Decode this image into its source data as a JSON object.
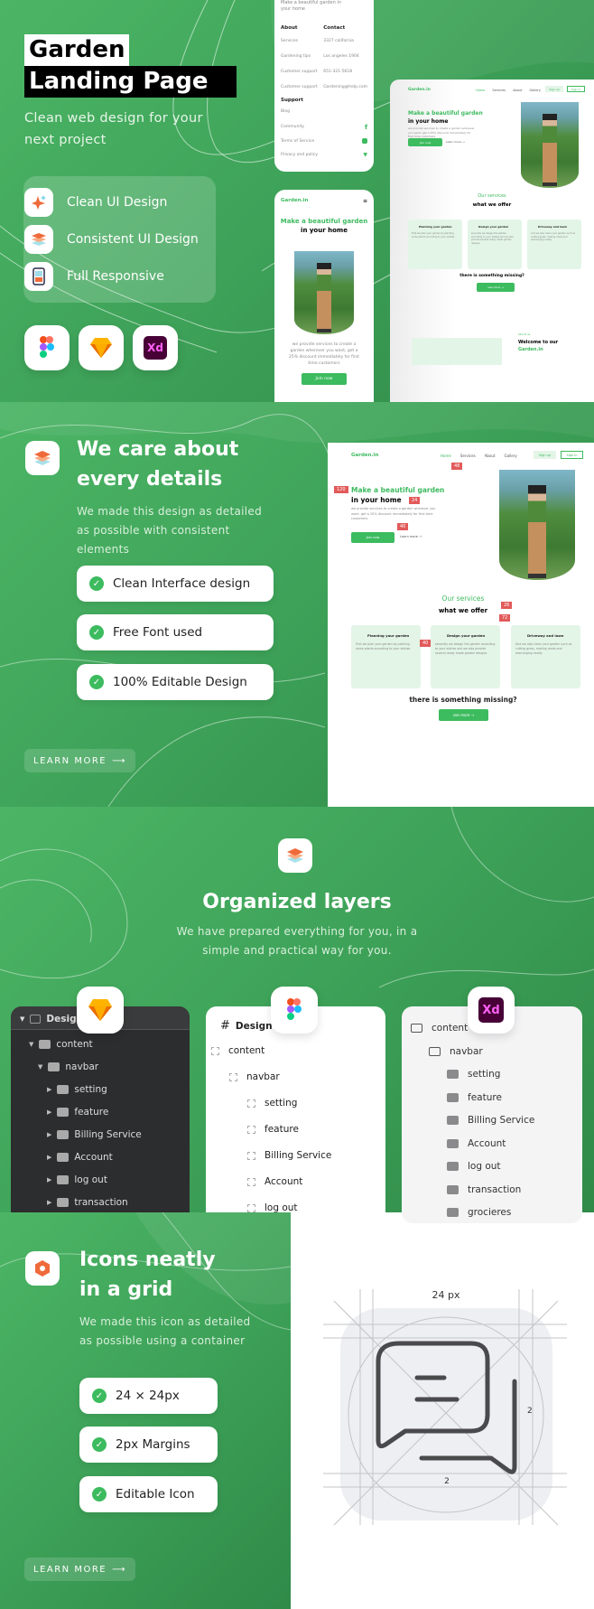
{
  "colors": {
    "brand_green": "#3dbb5f",
    "bg_green": "#3fa45a",
    "badge_red": "#e25a5a",
    "dark_panel": "#2c2d2e"
  },
  "hero": {
    "title_line1": "Garden",
    "title_line2": "Landing Page",
    "subtitle": "Clean web design for your next project",
    "features": [
      {
        "icon": "sparkle-icon",
        "label": "Clean UI Design"
      },
      {
        "icon": "layers-icon",
        "label": "Consistent UI Design"
      },
      {
        "icon": "phone-icon",
        "label": "Full Responsive"
      }
    ],
    "tools": [
      {
        "icon": "figma-icon"
      },
      {
        "icon": "sketch-icon"
      },
      {
        "icon": "xd-icon",
        "label": "Xd"
      }
    ]
  },
  "mock_footer": {
    "tagline": "Make a beautiful garden in your home",
    "about_title": "About",
    "contact_title": "Contact",
    "about": [
      "Services",
      "Gardening tips",
      "Customer support",
      "Customer support"
    ],
    "contact": [
      "3327 california",
      "Los angeles 1904",
      "651-321-5618",
      "Gardening@help.com"
    ],
    "support_title": "Support",
    "support": [
      "Blog",
      "Community",
      "Terms of Service",
      "Privacy and policy"
    ]
  },
  "mock_site": {
    "logo": "Garden.in",
    "nav": [
      "Home",
      "Services",
      "About",
      "Gallery"
    ],
    "signup": "Sign up",
    "signin": "Sign in",
    "hero_green": "Make a beautiful garden",
    "hero_dark": "in your home",
    "hero_text": "we provide services to create a garden wherever you want, get a 25% discount immediately for first time customers",
    "join": "Join now",
    "learn": "Learn more →",
    "services_kicker": "Our services",
    "services_title": "what we offer",
    "services": [
      {
        "title": "Planning your garden",
        "text": "First we plan your garden by planting some plants according to your wishes"
      },
      {
        "title": "Design your garden",
        "text": "secondly we design the garden according to your wishes and we also provide several ready made garden designs"
      },
      {
        "title": "Driveway and lawn",
        "text": "And we also clean your garden such as cutting grass, making roads and rearranging neatly"
      }
    ],
    "missing": "there is something missing?",
    "see_more": "see more →",
    "about_kicker": "About us",
    "about_title1": "Welcome to our",
    "about_title2": "Garden.in",
    "spacing": [
      "48",
      "120",
      "24",
      "40",
      "26",
      "72",
      "40"
    ]
  },
  "details": {
    "title_line1": "We care about",
    "title_line2": "every details",
    "subtitle": "We made this design as detailed as possible with consistent elements",
    "pills": [
      "Clean Interface design",
      "Free Font used",
      "100% Editable Design"
    ],
    "learn_more": "LEARN MORE"
  },
  "layers": {
    "title": "Organized layers",
    "subtitle": "We have prepared everything for you, in a simple and practical way for you.",
    "sketch": {
      "root": "Design",
      "items": [
        "content",
        "navbar",
        "setting",
        "feature",
        "Billing Service",
        "Account",
        "log out",
        "transaction"
      ]
    },
    "figma": {
      "root": "Design",
      "items": [
        "content",
        "navbar",
        "setting",
        "feature",
        "Billing Service",
        "Account",
        "log out"
      ]
    },
    "xd": {
      "items": [
        "content",
        "navbar",
        "setting",
        "feature",
        "Billing Service",
        "Account",
        "log out",
        "transaction",
        "grocieres"
      ],
      "logo": "Xd"
    }
  },
  "icons": {
    "title_line1": "Icons neatly",
    "title_line2": "in a grid",
    "subtitle": "We made this icon as detailed as possible using a container",
    "pills": [
      "24 × 24px",
      "2px Margins",
      "Editable Icon"
    ],
    "learn_more": "LEARN MORE",
    "grid_size": "24 px",
    "margin_right": "2",
    "margin_bottom": "2",
    "sample_icon": "chat-bubbles-icon"
  }
}
